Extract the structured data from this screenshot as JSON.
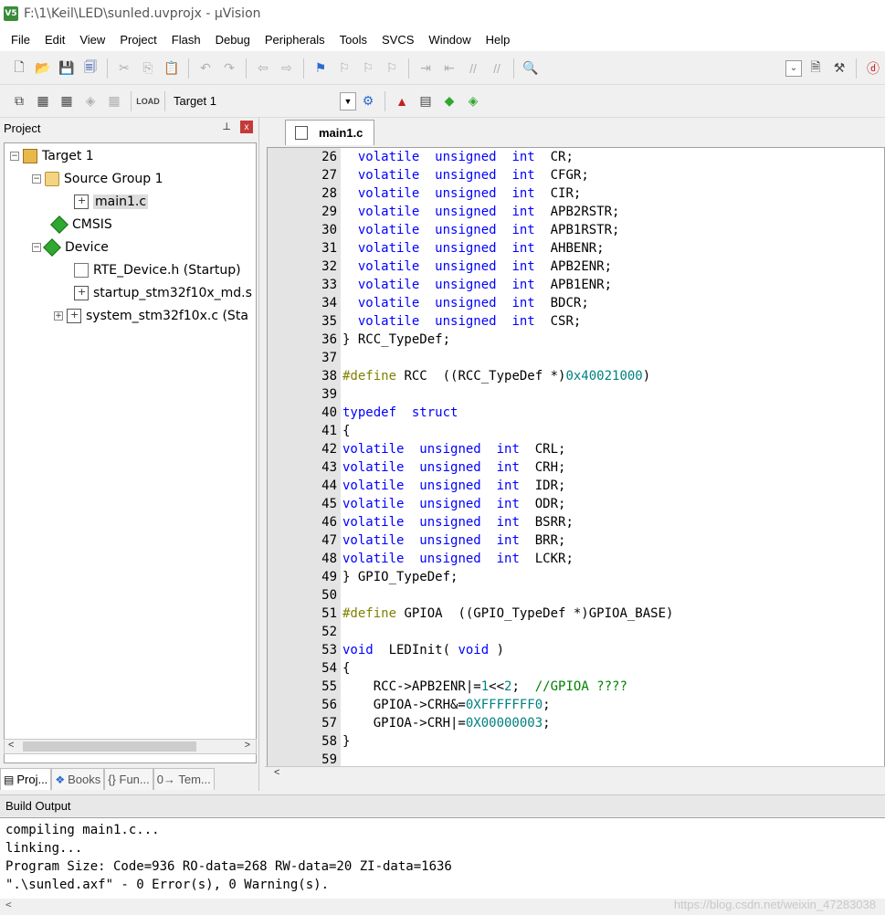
{
  "window": {
    "title": "F:\\1\\Keil\\LED\\sunled.uvprojx - µVision",
    "icon_text": "V5"
  },
  "menu": [
    "File",
    "Edit",
    "View",
    "Project",
    "Flash",
    "Debug",
    "Peripherals",
    "Tools",
    "SVCS",
    "Window",
    "Help"
  ],
  "toolbar2": {
    "target_value": "Target 1"
  },
  "project_panel": {
    "title": "Project",
    "pin_glyph": "⊥",
    "close_glyph": "x",
    "tree": [
      {
        "label": "Target 1",
        "level": 0,
        "expander": "−",
        "icon": "target-icon"
      },
      {
        "label": "Source Group 1",
        "level": 1,
        "expander": "−",
        "icon": "folder-icon"
      },
      {
        "label": "main1.c",
        "level": 2,
        "expander": "",
        "icon": "c-file-icon",
        "selected": true
      },
      {
        "label": "CMSIS",
        "level": 1,
        "expander": "",
        "icon": "component-icon"
      },
      {
        "label": "Device",
        "level": 1,
        "expander": "−",
        "icon": "component-icon"
      },
      {
        "label": "RTE_Device.h (Startup)",
        "level": 2,
        "expander": "",
        "icon": "header-file-icon"
      },
      {
        "label": "startup_stm32f10x_md.s",
        "level": 2,
        "expander": "",
        "icon": "asm-file-icon"
      },
      {
        "label": "system_stm32f10x.c (Sta",
        "level": 2,
        "expander": "+",
        "icon": "c-file-icon"
      }
    ],
    "tabs": [
      "Proj...",
      "Books",
      "{} Fun...",
      "0→ Tem..."
    ]
  },
  "editor": {
    "active_tab": "main1.c",
    "lines": [
      {
        "n": "26",
        "t": [
          [
            "  ",
            ""
          ],
          [
            "volatile",
            "kw"
          ],
          [
            "  ",
            ""
          ],
          [
            "unsigned",
            "kw"
          ],
          [
            "  ",
            ""
          ],
          [
            "int",
            "kw"
          ],
          [
            "  CR;",
            ""
          ]
        ]
      },
      {
        "n": "27",
        "t": [
          [
            "  ",
            ""
          ],
          [
            "volatile",
            "kw"
          ],
          [
            "  ",
            ""
          ],
          [
            "unsigned",
            "kw"
          ],
          [
            "  ",
            ""
          ],
          [
            "int",
            "kw"
          ],
          [
            "  CFGR;",
            ""
          ]
        ]
      },
      {
        "n": "28",
        "t": [
          [
            "  ",
            ""
          ],
          [
            "volatile",
            "kw"
          ],
          [
            "  ",
            ""
          ],
          [
            "unsigned",
            "kw"
          ],
          [
            "  ",
            ""
          ],
          [
            "int",
            "kw"
          ],
          [
            "  CIR;",
            ""
          ]
        ]
      },
      {
        "n": "29",
        "t": [
          [
            "  ",
            ""
          ],
          [
            "volatile",
            "kw"
          ],
          [
            "  ",
            ""
          ],
          [
            "unsigned",
            "kw"
          ],
          [
            "  ",
            ""
          ],
          [
            "int",
            "kw"
          ],
          [
            "  APB2RSTR;",
            ""
          ]
        ]
      },
      {
        "n": "30",
        "t": [
          [
            "  ",
            ""
          ],
          [
            "volatile",
            "kw"
          ],
          [
            "  ",
            ""
          ],
          [
            "unsigned",
            "kw"
          ],
          [
            "  ",
            ""
          ],
          [
            "int",
            "kw"
          ],
          [
            "  APB1RSTR;",
            ""
          ]
        ]
      },
      {
        "n": "31",
        "t": [
          [
            "  ",
            ""
          ],
          [
            "volatile",
            "kw"
          ],
          [
            "  ",
            ""
          ],
          [
            "unsigned",
            "kw"
          ],
          [
            "  ",
            ""
          ],
          [
            "int",
            "kw"
          ],
          [
            "  AHBENR;",
            ""
          ]
        ]
      },
      {
        "n": "32",
        "t": [
          [
            "  ",
            ""
          ],
          [
            "volatile",
            "kw"
          ],
          [
            "  ",
            ""
          ],
          [
            "unsigned",
            "kw"
          ],
          [
            "  ",
            ""
          ],
          [
            "int",
            "kw"
          ],
          [
            "  APB2ENR;",
            ""
          ]
        ]
      },
      {
        "n": "33",
        "t": [
          [
            "  ",
            ""
          ],
          [
            "volatile",
            "kw"
          ],
          [
            "  ",
            ""
          ],
          [
            "unsigned",
            "kw"
          ],
          [
            "  ",
            ""
          ],
          [
            "int",
            "kw"
          ],
          [
            "  APB1ENR;",
            ""
          ]
        ]
      },
      {
        "n": "34",
        "t": [
          [
            "  ",
            ""
          ],
          [
            "volatile",
            "kw"
          ],
          [
            "  ",
            ""
          ],
          [
            "unsigned",
            "kw"
          ],
          [
            "  ",
            ""
          ],
          [
            "int",
            "kw"
          ],
          [
            "  BDCR;",
            ""
          ]
        ]
      },
      {
        "n": "35",
        "t": [
          [
            "  ",
            ""
          ],
          [
            "volatile",
            "kw"
          ],
          [
            "  ",
            ""
          ],
          [
            "unsigned",
            "kw"
          ],
          [
            "  ",
            ""
          ],
          [
            "int",
            "kw"
          ],
          [
            "  CSR;",
            ""
          ]
        ]
      },
      {
        "n": "36",
        "t": [
          [
            "} RCC_TypeDef;",
            ""
          ]
        ]
      },
      {
        "n": "37",
        "t": []
      },
      {
        "n": "38",
        "t": [
          [
            "#define",
            "pp"
          ],
          [
            " RCC  ((RCC_TypeDef *)",
            ""
          ],
          [
            "0x40021000",
            "num"
          ],
          [
            ")",
            ""
          ]
        ]
      },
      {
        "n": "39",
        "t": []
      },
      {
        "n": "40",
        "t": [
          [
            "typedef",
            "kw"
          ],
          [
            "  ",
            ""
          ],
          [
            "struct",
            "kw"
          ]
        ]
      },
      {
        "n": "41",
        "t": [
          [
            "{",
            ""
          ]
        ]
      },
      {
        "n": "42",
        "t": [
          [
            "volatile",
            "kw"
          ],
          [
            "  ",
            ""
          ],
          [
            "unsigned",
            "kw"
          ],
          [
            "  ",
            ""
          ],
          [
            "int",
            "kw"
          ],
          [
            "  CRL;",
            ""
          ]
        ]
      },
      {
        "n": "43",
        "t": [
          [
            "volatile",
            "kw"
          ],
          [
            "  ",
            ""
          ],
          [
            "unsigned",
            "kw"
          ],
          [
            "  ",
            ""
          ],
          [
            "int",
            "kw"
          ],
          [
            "  CRH;",
            ""
          ]
        ]
      },
      {
        "n": "44",
        "t": [
          [
            "volatile",
            "kw"
          ],
          [
            "  ",
            ""
          ],
          [
            "unsigned",
            "kw"
          ],
          [
            "  ",
            ""
          ],
          [
            "int",
            "kw"
          ],
          [
            "  IDR;",
            ""
          ]
        ]
      },
      {
        "n": "45",
        "t": [
          [
            "volatile",
            "kw"
          ],
          [
            "  ",
            ""
          ],
          [
            "unsigned",
            "kw"
          ],
          [
            "  ",
            ""
          ],
          [
            "int",
            "kw"
          ],
          [
            "  ODR;",
            ""
          ]
        ]
      },
      {
        "n": "46",
        "t": [
          [
            "volatile",
            "kw"
          ],
          [
            "  ",
            ""
          ],
          [
            "unsigned",
            "kw"
          ],
          [
            "  ",
            ""
          ],
          [
            "int",
            "kw"
          ],
          [
            "  BSRR;",
            ""
          ]
        ]
      },
      {
        "n": "47",
        "t": [
          [
            "volatile",
            "kw"
          ],
          [
            "  ",
            ""
          ],
          [
            "unsigned",
            "kw"
          ],
          [
            "  ",
            ""
          ],
          [
            "int",
            "kw"
          ],
          [
            "  BRR;",
            ""
          ]
        ]
      },
      {
        "n": "48",
        "t": [
          [
            "volatile",
            "kw"
          ],
          [
            "  ",
            ""
          ],
          [
            "unsigned",
            "kw"
          ],
          [
            "  ",
            ""
          ],
          [
            "int",
            "kw"
          ],
          [
            "  LCKR;",
            ""
          ]
        ]
      },
      {
        "n": "49",
        "t": [
          [
            "} GPIO_TypeDef;",
            ""
          ]
        ]
      },
      {
        "n": "50",
        "t": []
      },
      {
        "n": "51",
        "t": [
          [
            "#define",
            "pp"
          ],
          [
            " GPIOA  ((GPIO_TypeDef *)GPIOA_BASE)",
            ""
          ]
        ]
      },
      {
        "n": "52",
        "t": []
      },
      {
        "n": "53",
        "t": [
          [
            "void",
            "kw"
          ],
          [
            "  LEDInit( ",
            ""
          ],
          [
            "void",
            "kw"
          ],
          [
            " )",
            ""
          ]
        ]
      },
      {
        "n": "54",
        "t": [
          [
            "{",
            ""
          ]
        ]
      },
      {
        "n": "55",
        "t": [
          [
            "    RCC->APB2ENR|=",
            ""
          ],
          [
            "1",
            "num"
          ],
          [
            "<<",
            ""
          ],
          [
            "2",
            "num"
          ],
          [
            ";  ",
            ""
          ],
          [
            "//GPIOA ????",
            "cm"
          ]
        ]
      },
      {
        "n": "56",
        "t": [
          [
            "    GPIOA->CRH&=",
            ""
          ],
          [
            "0XFFFFFFF0",
            "num"
          ],
          [
            ";",
            ""
          ]
        ]
      },
      {
        "n": "57",
        "t": [
          [
            "    GPIOA->CRH|=",
            ""
          ],
          [
            "0X00000003",
            "num"
          ],
          [
            ";",
            ""
          ]
        ]
      },
      {
        "n": "58",
        "t": [
          [
            "}",
            ""
          ]
        ]
      },
      {
        "n": "59",
        "t": []
      }
    ]
  },
  "build_output": {
    "title": "Build Output",
    "lines": [
      "compiling main1.c...",
      "linking...",
      "Program Size: Code=936 RO-data=268 RW-data=20 ZI-data=1636",
      "\".\\sunled.axf\" - 0 Error(s), 0 Warning(s)."
    ],
    "watermark": "https://blog.csdn.net/weixin_47283038"
  },
  "colors": {
    "keyword": "#0000ff",
    "preprocessor": "#808000",
    "number": "#008080",
    "comment": "#008000"
  }
}
